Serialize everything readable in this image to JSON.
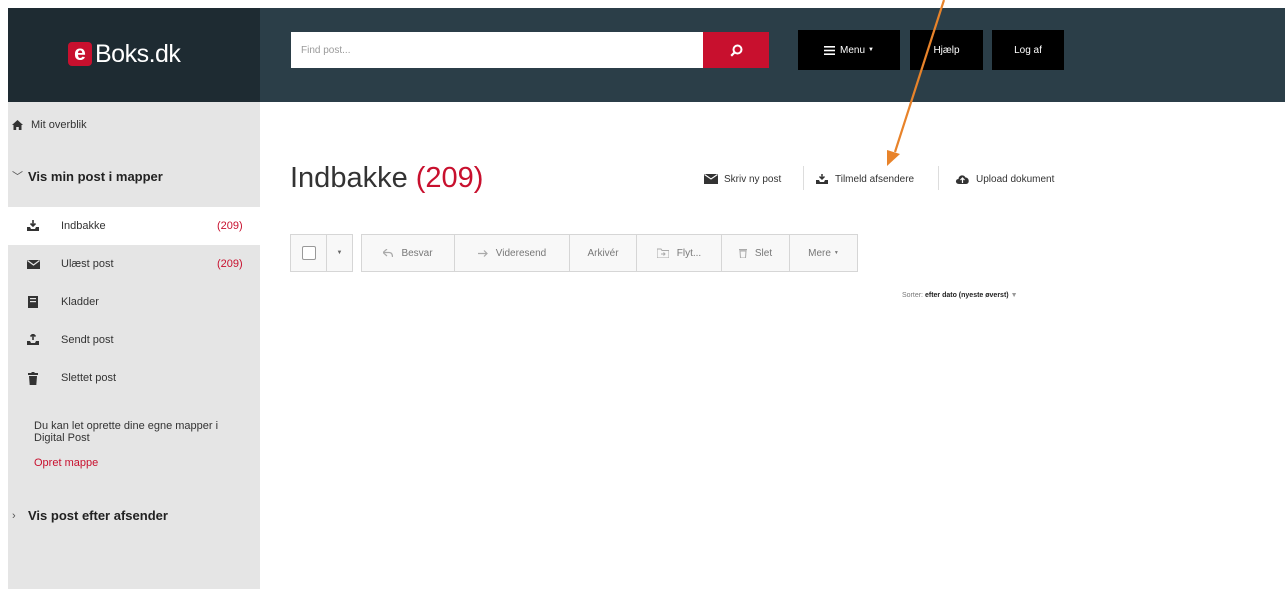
{
  "brand": {
    "logo_letter": "e",
    "logo_text": "Boks.dk",
    "accent_color": "#c8102e"
  },
  "header": {
    "search_placeholder": "Find post...",
    "menu_label": "Menu",
    "help_label": "Hjælp",
    "logout_label": "Log af"
  },
  "sidebar": {
    "overview_label": "Mit overblik",
    "mapper_section_label": "Vis min post i mapper",
    "folders": [
      {
        "label": "Indbakke",
        "count": "(209)",
        "icon": "inbox-icon",
        "active": true
      },
      {
        "label": "Ulæst post",
        "count": "(209)",
        "icon": "envelope-icon",
        "active": false
      },
      {
        "label": "Kladder",
        "count": "",
        "icon": "draft-icon",
        "active": false
      },
      {
        "label": "Sendt post",
        "count": "",
        "icon": "outbox-icon",
        "active": false
      },
      {
        "label": "Slettet post",
        "count": "",
        "icon": "trash-icon",
        "active": false
      }
    ],
    "info_text": "Du kan let oprette dine egne mapper i Digital Post",
    "create_folder_label": "Opret mappe",
    "sender_section_label": "Vis post efter afsender"
  },
  "main": {
    "title": "Indbakke",
    "title_count": "(209)",
    "actions": {
      "write_label": "Skriv ny post",
      "subscribe_label": "Tilmeld afsendere",
      "upload_label": "Upload dokument"
    },
    "toolbar": {
      "reply_label": "Besvar",
      "forward_label": "Videresend",
      "archive_label": "Arkivér",
      "move_label": "Flyt...",
      "delete_label": "Slet",
      "more_label": "Mere"
    },
    "sort": {
      "prefix": "Sorter:",
      "value": "efter dato (nyeste øverst)"
    }
  },
  "annotation": {
    "arrow_color": "#e8832a"
  }
}
